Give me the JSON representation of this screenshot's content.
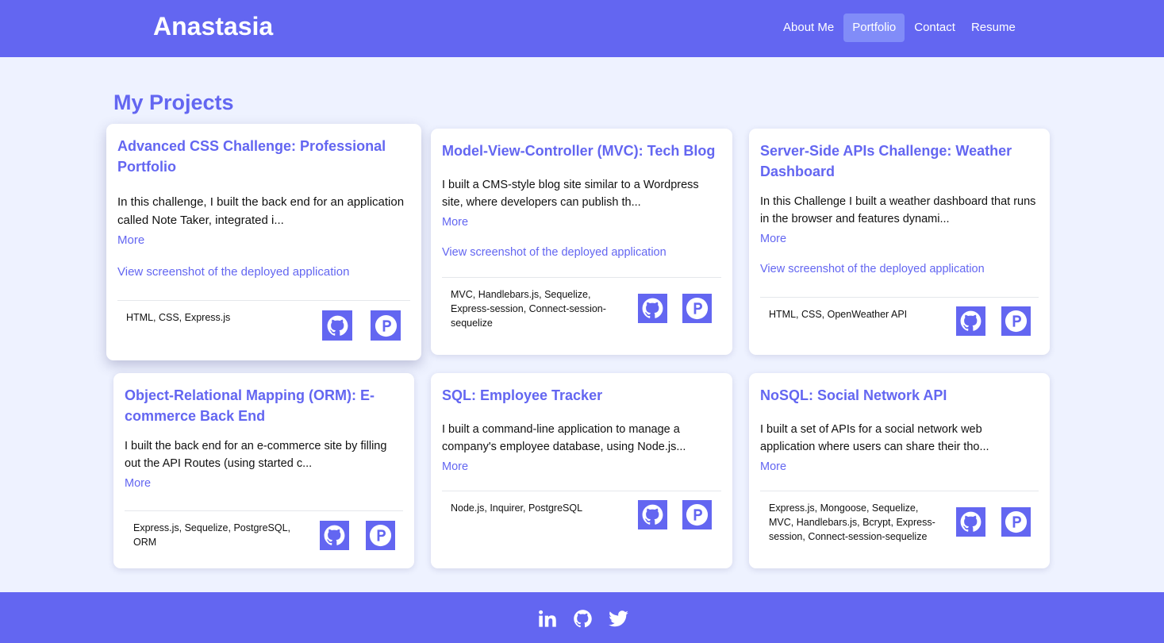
{
  "header": {
    "brand": "Anastasia",
    "nav": [
      {
        "label": "About Me",
        "active": false
      },
      {
        "label": "Portfolio",
        "active": true
      },
      {
        "label": "Contact",
        "active": false
      },
      {
        "label": "Resume",
        "active": false
      }
    ]
  },
  "main": {
    "title": "My Projects",
    "projects": [
      {
        "title": "Advanced CSS Challenge: Professional Portfolio",
        "description": "In this challenge, I built the back end for an application called Note Taker, integrated i...",
        "more_label": "More",
        "screenshot_label": "View screenshot of the deployed application",
        "tech": "HTML, CSS, Express.js",
        "icons": [
          "github-icon",
          "deployed-app-icon"
        ]
      },
      {
        "title": "Model-View-Controller (MVC): Tech Blog",
        "description": "I built a CMS-style blog site similar to a Wordpress site, where developers can publish th...",
        "more_label": "More",
        "screenshot_label": "View screenshot of the deployed application",
        "tech": "MVC, Handlebars.js, Sequelize, Express-session, Connect-session-sequelize",
        "icons": [
          "github-icon",
          "deployed-app-icon"
        ]
      },
      {
        "title": "Server-Side APIs Challenge: Weather Dashboard",
        "description": "In this Challenge I built a weather dashboard that runs in the browser and features dynami...",
        "more_label": "More",
        "screenshot_label": "View screenshot of the deployed application",
        "tech": "HTML, CSS, OpenWeather API",
        "icons": [
          "github-icon",
          "deployed-app-icon"
        ]
      },
      {
        "title": "Object-Relational Mapping (ORM): E-commerce Back End",
        "description": "I built the back end for an e-commerce site by filling out the API Routes (using started c...",
        "more_label": "More",
        "tech": "Express.js, Sequelize, PostgreSQL, ORM",
        "icons": [
          "github-icon",
          "deployed-app-icon"
        ]
      },
      {
        "title": "SQL: Employee Tracker",
        "description": "I built a command-line application to manage a company's employee database, using Node.js...",
        "more_label": "More",
        "tech": "Node.js, Inquirer, PostgreSQL",
        "icons": [
          "github-icon",
          "deployed-app-icon"
        ]
      },
      {
        "title": "NoSQL: Social Network API",
        "description": "I built a set of APIs for a social network web application where users can share their tho...",
        "more_label": "More",
        "tech": "Express.js, Mongoose, Sequelize, MVC, Handlebars.js, Bcrypt, Express-session, Connect-session-sequelize",
        "icons": [
          "github-icon",
          "deployed-app-icon"
        ]
      }
    ]
  },
  "footer": {
    "social_icons": [
      "linkedin-icon",
      "github-icon",
      "twitter-icon"
    ]
  },
  "colors": {
    "accent": "#6366f1",
    "active_nav": "#818cf8",
    "page_background": "#eef2ff",
    "card_background": "#ffffff"
  }
}
